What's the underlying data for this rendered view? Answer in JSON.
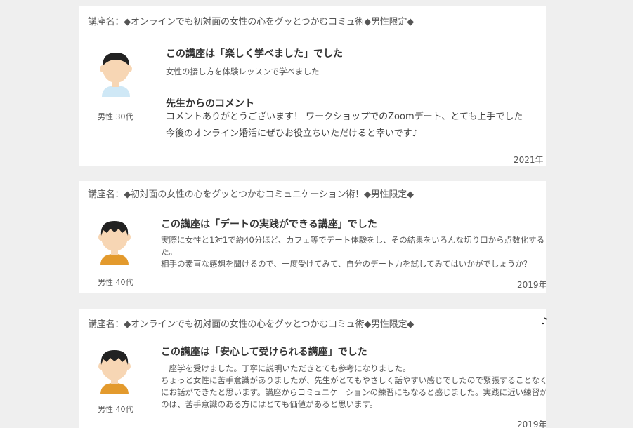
{
  "reviews": [
    {
      "course": "講座名：◆オンラインでも初対面の女性の心をグッとつかむコミュ術◆男性限定◆",
      "user": "男性 30代",
      "headline": "この講座は「楽しく学べました」でした",
      "body": [
        "女性の接し方を体験レッスンで学べました"
      ],
      "comment_title": "先生からのコメント",
      "comment": [
        "コメントありがとうございます！ ワークショップでのZoomデート、とても上手でした",
        "今後のオンライン婚活にぜひお役立ちいただけると幸いです♪"
      ],
      "date": "2021年"
    },
    {
      "course": "講座名：◆初対面の女性の心をグッとつかむコミュニケーション術！◆男性限定◆",
      "user": "男性 40代",
      "headline": "この講座は「デートの実践ができる講座」でした",
      "body": [
        "実際に女性と1対1で約40分ほど、カフェ等でデート体験をし、その結果をいろんな切り口から点数化する",
        "た。",
        "相手の素直な感想を聞けるので、一度受けてみて、自分のデート力を試してみてはいかがでしょうか？"
      ],
      "date": "2019年"
    },
    {
      "course": "講座名：◆オンラインでも初対面の女性の心をグッとつかむコミュ術◆男性限定◆",
      "user": "男性 40代",
      "headline": "この講座は「安心して受けられる講座」でした",
      "body": [
        "　座学を受けました。丁寧に説明いただきとても参考になりました。",
        "ちょっと女性に苦手意識がありましたが、先生がとてもやさしく話やすい感じでしたので緊張することなく",
        "にお話ができたと思います。講座からコミュニケーションの練習にもなると感じました。実践に近い練習が",
        "のは、苦手意識のある方にはとても価値があると思います。"
      ],
      "date": "2019年"
    }
  ],
  "stray_note": "♪"
}
